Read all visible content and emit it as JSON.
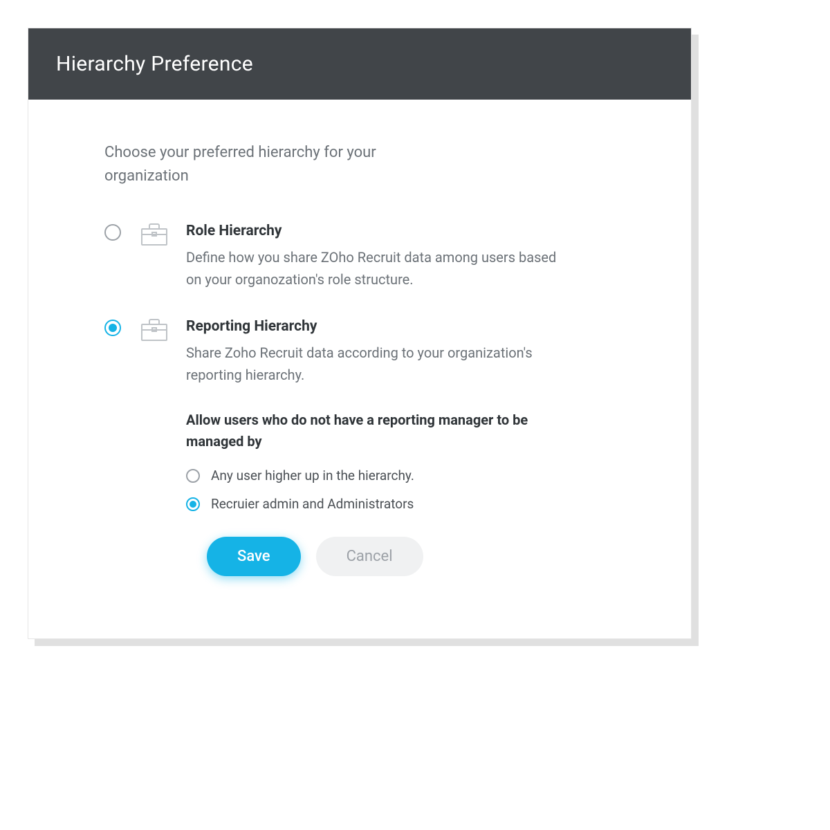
{
  "modal": {
    "title": "Hierarchy Preference",
    "intro": "Choose your preferred hierarchy for your organization",
    "options": [
      {
        "title": "Role Hierarchy",
        "description": "Define how you share ZOho Recruit data among users based on your organozation's role structure.",
        "selected": false
      },
      {
        "title": "Reporting Hierarchy",
        "description": "Share Zoho Recruit data according to your organization's reporting hierarchy.",
        "selected": true,
        "sub_heading": "Allow users who do not have a reporting manager to be managed by",
        "sub_options": [
          {
            "label": "Any user higher up in the hierarchy.",
            "selected": false
          },
          {
            "label": "Recruier admin and Administrators",
            "selected": true
          }
        ]
      }
    ],
    "buttons": {
      "save": "Save",
      "cancel": "Cancel"
    }
  },
  "colors": {
    "header_bg": "#414549",
    "accent": "#15b3e6",
    "text_muted": "#6b7177"
  }
}
